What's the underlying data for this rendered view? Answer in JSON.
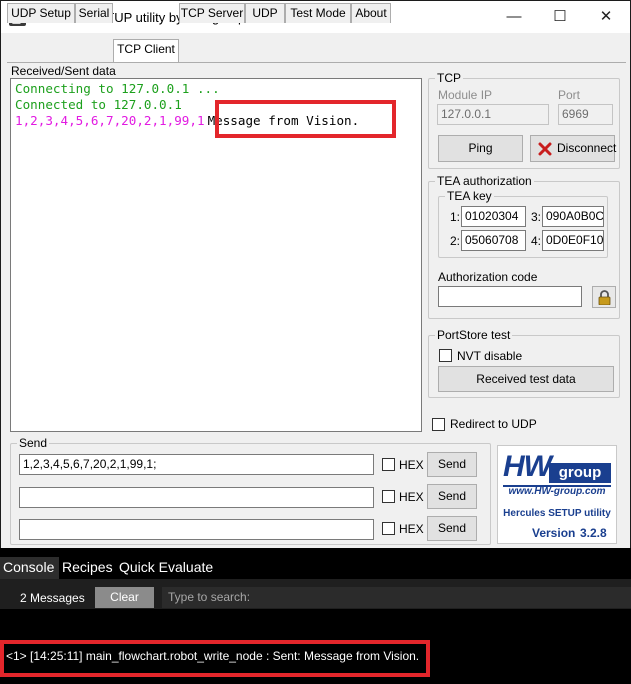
{
  "window": {
    "title": "Hercules SETUP utility by HW-group.com",
    "controls": {
      "minimize": "—",
      "maximize": "☐",
      "close": "✕"
    }
  },
  "tabs": [
    {
      "label": "UDP Setup"
    },
    {
      "label": "Serial"
    },
    {
      "label": "TCP Client",
      "active": true
    },
    {
      "label": "TCP Server"
    },
    {
      "label": "UDP"
    },
    {
      "label": "Test Mode"
    },
    {
      "label": "About"
    }
  ],
  "received": {
    "label": "Received/Sent data",
    "lines": {
      "l1": "Connecting to 127.0.0.1 ...",
      "l2": "Connected to 127.0.0.1",
      "l3_prefix": "1,2,3,4,5,6,7,20,2,1,99,1",
      "l3_message": "Message from Vision."
    }
  },
  "tcp": {
    "title": "TCP",
    "module_ip_label": "Module IP",
    "module_ip_value": "127.0.0.1",
    "port_label": "Port",
    "port_value": "6969",
    "ping_label": "Ping",
    "disconnect_label": "Disconnect"
  },
  "tea": {
    "title": "TEA authorization",
    "key_title": "TEA key",
    "keys": [
      {
        "index": "1:",
        "value": "01020304"
      },
      {
        "index": "3:",
        "value": "090A0B0C"
      },
      {
        "index": "2:",
        "value": "05060708"
      },
      {
        "index": "4:",
        "value": "0D0E0F10"
      }
    ],
    "auth_label": "Authorization code",
    "auth_value": ""
  },
  "portstore": {
    "title": "PortStore test",
    "nvt_label": "NVT disable",
    "nvt_checked": false,
    "received_test_label": "Received test data"
  },
  "redirect": {
    "label": "Redirect to UDP",
    "checked": false
  },
  "send": {
    "title": "Send",
    "rows": [
      {
        "value": "1,2,3,4,5,6,7,20,2,1,99,1;",
        "hex_label": "HEX",
        "hex_checked": false,
        "send_label": "Send"
      },
      {
        "value": "",
        "hex_label": "HEX",
        "hex_checked": false,
        "send_label": "Send"
      },
      {
        "value": "",
        "hex_label": "HEX",
        "hex_checked": false,
        "send_label": "Send"
      }
    ]
  },
  "logo": {
    "brand": "HW",
    "brand_sub": "group",
    "url": "www.HW-group.com",
    "product": "Hercules SETUP utility",
    "version_label": "Version",
    "version": "3.2.8"
  },
  "console": {
    "tabs": [
      {
        "label": "Console",
        "active": true
      },
      {
        "label": "Recipes"
      },
      {
        "label": "Quick Evaluate"
      }
    ],
    "message_count": "2 Messages",
    "clear_label": "Clear",
    "search_placeholder": "Type to search:",
    "log_line": "<1> [14:25:11] main_flowchart.robot_write_node : Sent: Message from Vision."
  },
  "colors": {
    "highlight": "#e3262b",
    "connect_text": "#1da01d",
    "data_text": "#e21ae2",
    "logo_blue": "#1a3f8f"
  }
}
